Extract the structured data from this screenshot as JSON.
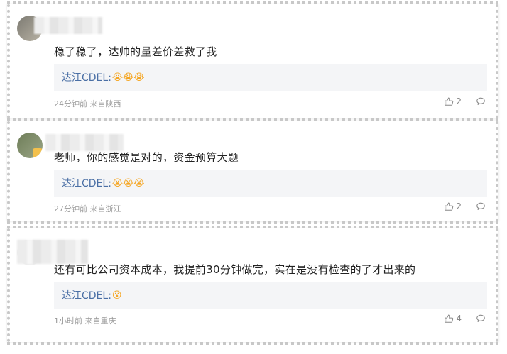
{
  "comments": [
    {
      "content": "稳了稳了，达帅的量差价差救了我",
      "reply_name": "达江CDEL:",
      "reply_emoji": "😭😭😭",
      "time": "24分钟前",
      "location": "来自陕西",
      "meta": "24分钟前 来自陕西",
      "likes": "2"
    },
    {
      "content": "老师，你的感觉是对的，资金预算大题",
      "reply_name": "达江CDEL:",
      "reply_emoji": "😭😭😭",
      "time": "27分钟前",
      "location": "来自浙江",
      "meta": "27分钟前 来自浙江",
      "likes": "2"
    },
    {
      "content": "还有可比公司资本成本，我提前30分钟做完，实在是没有检查的了才出来的",
      "reply_name": "达江CDEL:",
      "reply_emoji": "😮",
      "time": "1小时前",
      "location": "来自重庆",
      "meta": "1小时前 来自重庆",
      "likes": "4"
    }
  ],
  "icons": {
    "like": "thumbs-up-icon",
    "comment": "comment-bubble-icon"
  },
  "colors": {
    "reply_name": "#4a6fa5",
    "meta": "#999999",
    "reply_bg": "#f4f5f7"
  }
}
